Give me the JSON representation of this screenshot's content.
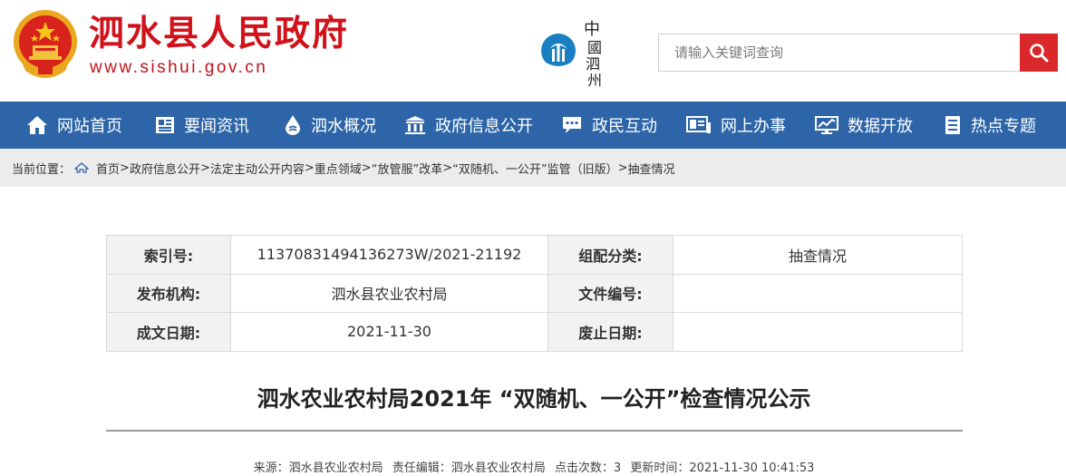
{
  "header": {
    "site_title": "泗水县人民政府",
    "site_url": "www.sishui.gov.cn",
    "center_logo_text": "中國泗州",
    "search_placeholder": "请输入关键词查询"
  },
  "nav": {
    "items": [
      {
        "label": "网站首页",
        "icon": "home-icon"
      },
      {
        "label": "要闻资讯",
        "icon": "news-icon"
      },
      {
        "label": "泗水概况",
        "icon": "water-drop-icon"
      },
      {
        "label": "政府信息公开",
        "icon": "government-building-icon"
      },
      {
        "label": "政民互动",
        "icon": "chat-bubble-icon"
      },
      {
        "label": "网上办事",
        "icon": "online-service-icon"
      },
      {
        "label": "数据开放",
        "icon": "monitor-icon"
      },
      {
        "label": "热点专题",
        "icon": "document-list-icon"
      }
    ],
    "background": "#2d65a8"
  },
  "breadcrumb": {
    "prefix": "当前位置：",
    "items": [
      "首页",
      "政府信息公开",
      "法定主动公开内容",
      "重点领域",
      "“放管服”改革",
      "“双随机、一公开”监管（旧版）",
      "抽查情况"
    ],
    "separator": ">"
  },
  "info": {
    "index_label": "索引号:",
    "index_value": "11370831494136273W/2021-21192",
    "category_label": "组配分类:",
    "category_value": "抽查情况",
    "publisher_label": "发布机构:",
    "publisher_value": "泗水县农业农村局",
    "doc_number_label": "文件编号:",
    "doc_number_value": "",
    "date_label": "成文日期:",
    "date_value": "2021-11-30",
    "expire_label": "废止日期:",
    "expire_value": ""
  },
  "article": {
    "title": "泗水农业农村局2021年 “双随机、一公开”检查情况公示",
    "source": "来源：泗水县农业农村局",
    "editor": "责任编辑：泗水县农业农村局",
    "clicks": "点击次数：3",
    "updated": "更新时间：2021-11-30 10:41:53"
  },
  "colors": {
    "brand_red": "#d0121b",
    "search_button": "#d9272a",
    "nav_blue": "#2d65a8"
  }
}
